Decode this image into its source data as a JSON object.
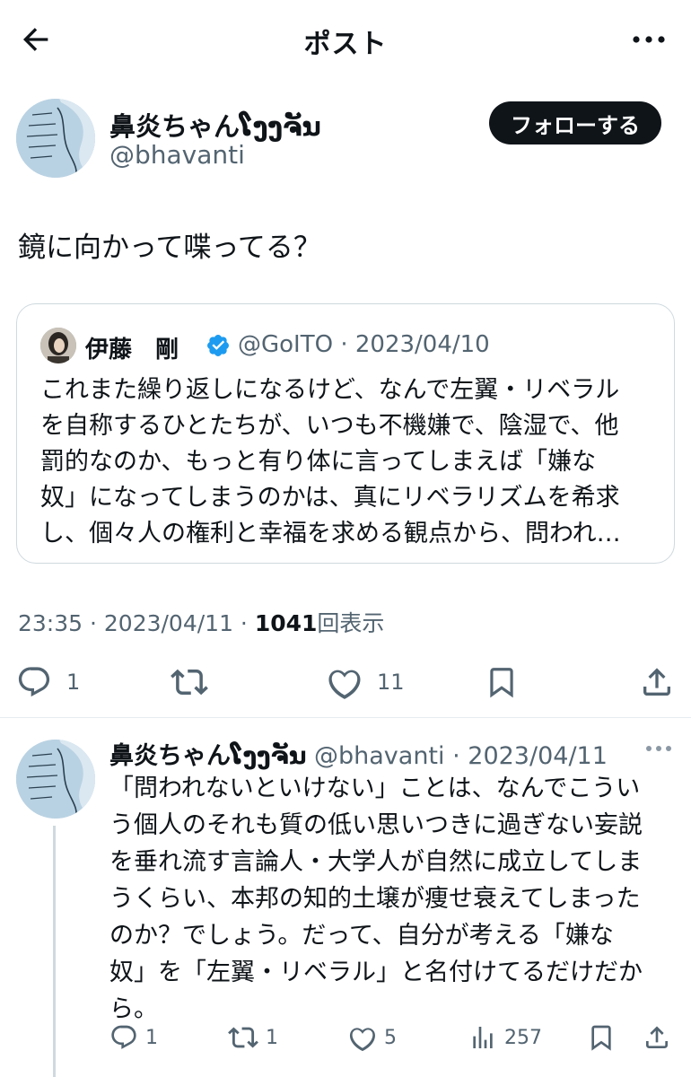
{
  "header": {
    "title": "ポスト"
  },
  "post": {
    "author_name": "鼻炎ちゃんໂງງຈັນ",
    "author_handle": "@bhavanti",
    "follow_label": "フォローする",
    "text": "鏡に向かって喋ってる？",
    "quote": {
      "name": "伊藤　剛",
      "meta": "@GoITO · 2023/04/10",
      "lines": [
        "これまた繰り返しになるけど、なんで左翼・リベラル",
        "を自称するひとたちが、いつも不機嫌で、陰湿で、他",
        "罰的なのか、もっと有り体に言ってしまえば「嫌な",
        "奴」になってしまうのかは、真にリベラリズムを希求",
        "し、個々人の権利と幸福を求める観点から、問われ…"
      ]
    },
    "time_prefix": "23:35 · 2023/04/11 · ",
    "views_count": "1041",
    "views_label": "回表示",
    "reply_count": "1",
    "like_count": "11"
  },
  "reply": {
    "author_name": "鼻炎ちゃんໂງງຈັນ",
    "meta": " @bhavanti · 2023/04/11",
    "lines": [
      "「問われないといけない」ことは、なんでこうい",
      "う個人のそれも質の低い思いつきに過ぎない妄説",
      "を垂れ流す言論人・大学人が自然に成立してしま",
      "うくらい、本邦の知的土壌が痩せ衰えてしまった",
      "のか？でしょう。だって、自分が考える「嫌な",
      "奴」を「左翼・リベラル」と名付けてるだけだか",
      "ら。"
    ],
    "reply_count": "1",
    "repost_count": "1",
    "like_count": "5",
    "view_count": "257"
  },
  "colors": {
    "text": "#0f1419",
    "secondary": "#536471",
    "verified": "#1d9bf0",
    "border": "#cfd9de"
  }
}
